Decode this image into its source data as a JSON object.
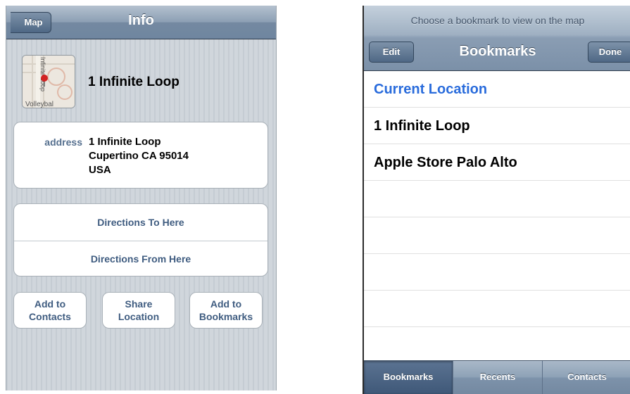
{
  "info": {
    "back_label": "Map",
    "title": "Info",
    "map_thumbnail_text": [
      "Infinite Loop",
      "Volleybal"
    ],
    "place_name": "1 Infinite Loop",
    "address_label": "address",
    "address_lines": [
      "1 Infinite Loop",
      "Cupertino CA 95014",
      "USA"
    ],
    "directions_to": "Directions To Here",
    "directions_from": "Directions From Here",
    "actions": [
      {
        "line1": "Add to",
        "line2": "Contacts"
      },
      {
        "line1": "Share",
        "line2": "Location"
      },
      {
        "line1": "Add to",
        "line2": "Bookmarks"
      }
    ]
  },
  "bookmarks": {
    "prompt": "Choose a bookmark to view on the map",
    "title": "Bookmarks",
    "edit_label": "Edit",
    "done_label": "Done",
    "items": [
      {
        "label": "Current Location"
      },
      {
        "label": "1 Infinite Loop"
      },
      {
        "label": "Apple Store Palo Alto"
      }
    ],
    "tabs": [
      {
        "label": "Bookmarks",
        "selected": true
      },
      {
        "label": "Recents",
        "selected": false
      },
      {
        "label": "Contacts",
        "selected": false
      }
    ]
  },
  "colors": {
    "link_blue": "#2a6cdc",
    "label_slate": "#56708f",
    "button_text": "#3f5c80",
    "pin_red": "#d22222"
  }
}
